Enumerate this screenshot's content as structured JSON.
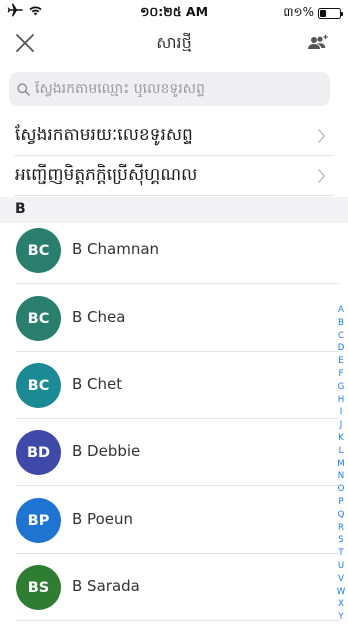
{
  "status_bar": {
    "time": "១០:២៥ AM",
    "battery_text": "៣១%",
    "battery_level_percent": 31
  },
  "nav": {
    "title": "សារថ្មី",
    "close_icon": "close-icon",
    "group_icon": "add-group-icon"
  },
  "search": {
    "placeholder": "ស្វែងរកតាមឈ្មោះ ឬលេខទូរសព្ទ",
    "value": "",
    "icon": "search-icon"
  },
  "options": [
    {
      "label": "ស្វែងរកតាមរយៈលេខទូរសព្ទ"
    },
    {
      "label": "អញ្ជើញមិត្តភក្តិប្រើស៊ីហ្គណល"
    }
  ],
  "section_header": "B",
  "contacts": [
    {
      "initials": "BC",
      "name": "B Chamnan",
      "color": "#2a7e6e"
    },
    {
      "initials": "BC",
      "name": "B Chea",
      "color": "#2a7e6e"
    },
    {
      "initials": "BC",
      "name": "B Chet",
      "color": "#1b8a95"
    },
    {
      "initials": "BD",
      "name": "B Debbie",
      "color": "#3f4aa8"
    },
    {
      "initials": "BP",
      "name": "B Poeun",
      "color": "#1f74d1"
    },
    {
      "initials": "BS",
      "name": "B Sarada",
      "color": "#2e7d32"
    }
  ],
  "index_letters": [
    "A",
    "B",
    "C",
    "D",
    "E",
    "F",
    "G",
    "H",
    "I",
    "J",
    "K",
    "L",
    "M",
    "N",
    "O",
    "P",
    "Q",
    "R",
    "S",
    "T",
    "U",
    "V",
    "W",
    "X",
    "Y"
  ],
  "colors": {
    "accent": "#1a7cf0",
    "search_bg": "#efeff1",
    "section_bg": "#f3f3f5"
  }
}
